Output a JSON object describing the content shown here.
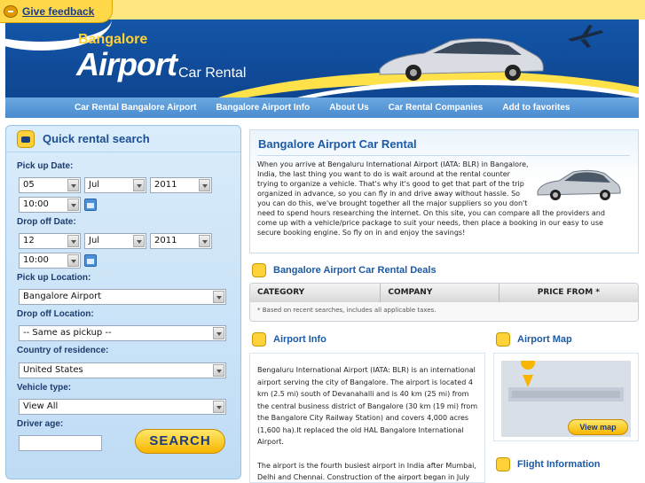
{
  "feedback": {
    "label": "Give feedback",
    "icon": "speech-bubble-icon"
  },
  "header": {
    "logo_city": "Bangalore",
    "logo_main": "Airport",
    "logo_sub": "Car Rental"
  },
  "nav": {
    "items": [
      "Car Rental Bangalore Airport",
      "Bangalore Airport Info",
      "About Us",
      "Car Rental Companies",
      "Add to favorites"
    ]
  },
  "search": {
    "title": "Quick rental search",
    "pickup_date_label": "Pick up Date:",
    "pickup_day": "05",
    "pickup_month": "Jul",
    "pickup_year": "2011",
    "pickup_time": "10:00",
    "dropoff_date_label": "Drop off Date:",
    "dropoff_day": "12",
    "dropoff_month": "Jul",
    "dropoff_year": "2011",
    "dropoff_time": "10:00",
    "pickup_location_label": "Pick up Location:",
    "pickup_location": "Bangalore Airport",
    "dropoff_location_label": "Drop off Location:",
    "dropoff_location": "-- Same as pickup --",
    "residence_label": "Country of residence:",
    "residence": "United States",
    "vehicle_label": "Vehicle type:",
    "vehicle": "View All",
    "age_label": "Driver age:",
    "age_value": "",
    "button": "SEARCH"
  },
  "main": {
    "title": "Bangalore Airport Car Rental",
    "intro": "When you arrive at Bengaluru International Airport (IATA: BLR) in Bangalore, India, the last thing you want to do is wait around at the rental counter trying to organize a vehicle. That's why it's good to get that part of the trip organized in advance, so you can fly in and drive away without hassle. So you can do this, we've brought together all the major suppliers so you don't need to spend hours researching the internet. On this site, you can compare all the providers and come up with a vehicle/price package to suit your needs, then place a booking in our easy to use secure booking engine. So fly on in and enjoy the savings!"
  },
  "deals": {
    "title": "Bangalore Airport Car Rental Deals",
    "col_category": "CATEGORY",
    "col_company": "COMPANY",
    "col_price": "PRICE FROM *",
    "note": "* Based on recent searches, includes all applicable taxes."
  },
  "info": {
    "title": "Airport Info",
    "para1": "Bengaluru International Airport (IATA: BLR) is an international airport serving the city of Bangalore. The airport is located 4 km (2.5 mi) south of Devanahalli and is 40 km (25 mi) from the central business district of Bangalore (30 km (19 mi) from the Bangalore City Railway Station) and covers 4,000 acres (1,600 ha).It replaced the old HAL Bangalore International Airport.",
    "para2": "The airport is the fourth busiest airport in India after Mumbai, Delhi and Chennai. Construction of the airport began in July"
  },
  "map": {
    "title": "Airport Map",
    "button": "View map"
  },
  "flight": {
    "title": "Flight Information"
  }
}
